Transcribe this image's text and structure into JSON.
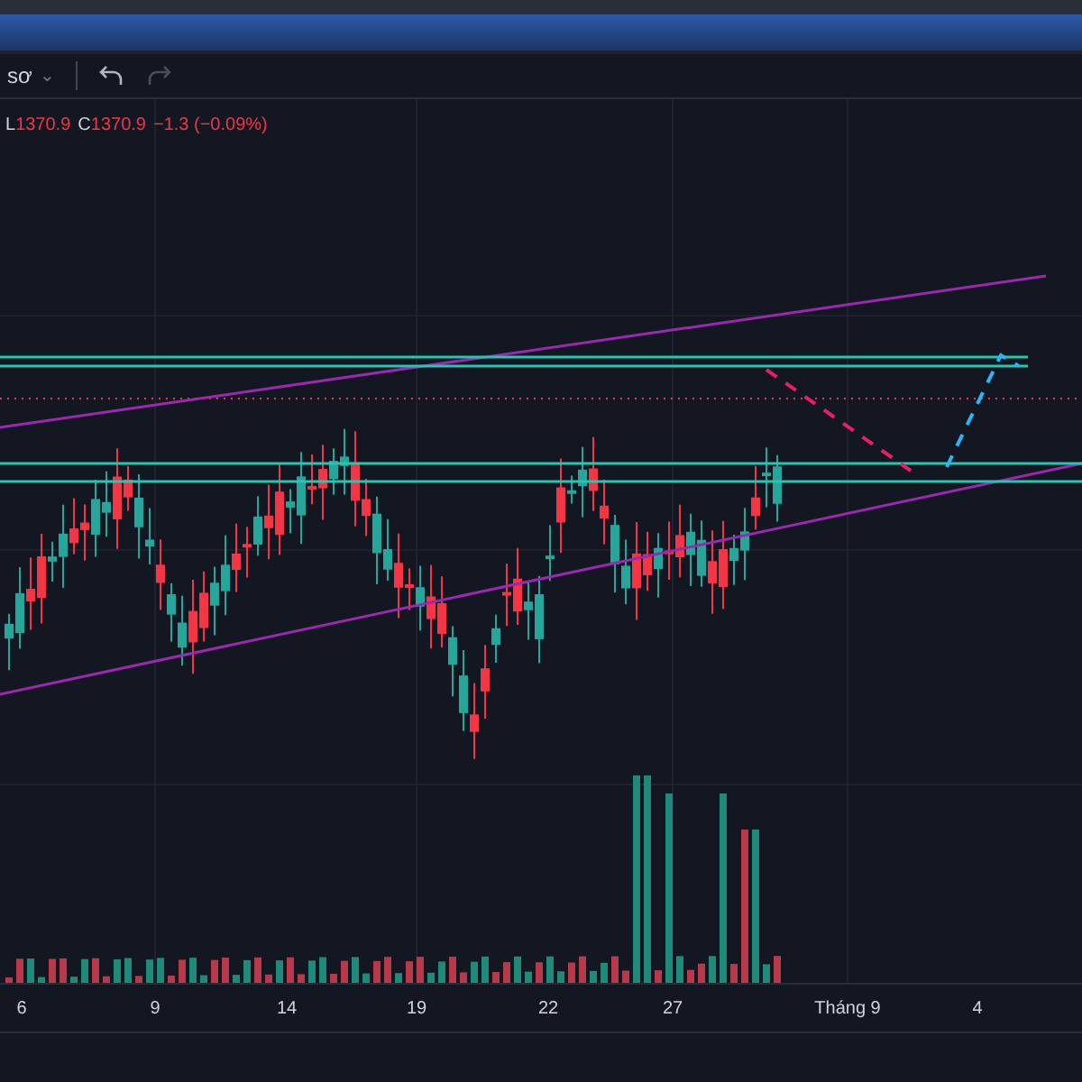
{
  "toolbar": {
    "interval": "sơ",
    "caret": "⌄"
  },
  "legend": [
    {
      "label": "L",
      "value": "1370.9"
    },
    {
      "label": "C",
      "value": "1370.9"
    }
  ],
  "change": "−1.3 (−0.09%)",
  "time_axis": [
    "6",
    "9",
    "14",
    "19",
    "22",
    "27",
    "Tháng 9",
    "4"
  ]
}
